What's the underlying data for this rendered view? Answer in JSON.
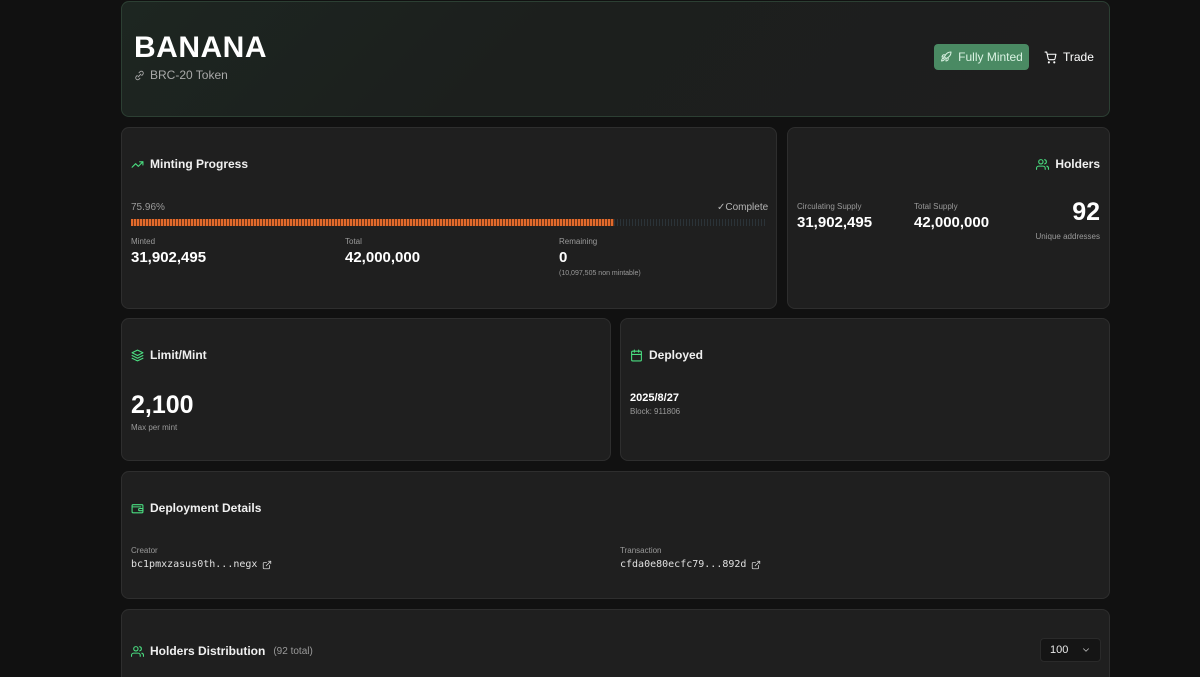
{
  "header": {
    "token_name": "BANANA",
    "token_type": "BRC-20 Token",
    "status_button": "Fully Minted",
    "trade_button": "Trade"
  },
  "minting": {
    "title": "Minting Progress",
    "percent_label": "75.96%",
    "progress_fraction": 0.7596,
    "complete_label": "✓Complete",
    "minted_label": "Minted",
    "minted_value": "31,902,495",
    "total_label": "Total",
    "total_value": "42,000,000",
    "remaining_label": "Remaining",
    "remaining_value": "0",
    "remaining_note": "(10,097,505 non mintable)"
  },
  "holders": {
    "title": "Holders",
    "circulating_label": "Circulating Supply",
    "circulating_value": "31,902,495",
    "total_supply_label": "Total Supply",
    "total_supply_value": "42,000,000",
    "holders_count": "92",
    "holders_caption": "Unique addresses"
  },
  "limit": {
    "title": "Limit/Mint",
    "value": "2,100",
    "caption": "Max per mint"
  },
  "deployed": {
    "title": "Deployed",
    "date": "2025/8/27",
    "block": "Block: 911806"
  },
  "deployment_details": {
    "title": "Deployment Details",
    "creator_label": "Creator",
    "creator_value": "bc1pmxzasus0th...negx",
    "transaction_label": "Transaction",
    "transaction_value": "cfda0e80ecfc79...892d"
  },
  "distribution": {
    "title": "Holders Distribution",
    "total_note": "(92 total)",
    "page_size": "100"
  },
  "colors": {
    "accent_green": "#4ade80",
    "button_green": "#4a8a63",
    "progress_orange": "#e26a2c",
    "background": "#111111",
    "card": "#1f1f1f"
  }
}
